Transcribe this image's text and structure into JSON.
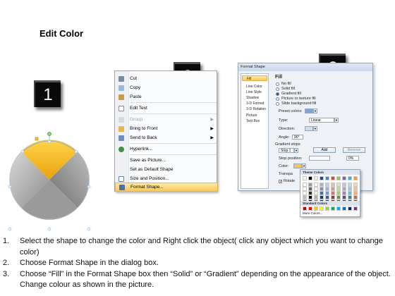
{
  "title": "Edit Color",
  "step_boxes": [
    "1",
    "2",
    "3"
  ],
  "context_menu": {
    "items": [
      {
        "label": "Cut",
        "icon": "scissors-icon",
        "disabled": false,
        "submenu": false
      },
      {
        "label": "Copy",
        "icon": "copy-icon",
        "disabled": false,
        "submenu": false
      },
      {
        "label": "Paste",
        "icon": "paste-icon",
        "disabled": false,
        "submenu": false
      },
      {
        "label": "Edit Text",
        "icon": "edit-text-icon",
        "disabled": false,
        "submenu": false
      },
      {
        "label": "Group",
        "icon": "group-icon",
        "disabled": true,
        "submenu": true
      },
      {
        "label": "Bring to Front",
        "icon": "bring-to-front-icon",
        "disabled": false,
        "submenu": true
      },
      {
        "label": "Send to Back",
        "icon": "send-to-back-icon",
        "disabled": false,
        "submenu": true
      },
      {
        "label": "Hyperlink...",
        "icon": "hyperlink-icon",
        "disabled": false,
        "submenu": false
      },
      {
        "label": "Save as Picture...",
        "icon": "",
        "disabled": false,
        "submenu": false
      },
      {
        "label": "Set as Default Shape",
        "icon": "",
        "disabled": false,
        "submenu": false
      },
      {
        "label": "Size and Position...",
        "icon": "size-position-icon",
        "disabled": false,
        "submenu": false
      },
      {
        "label": "Format Shape...",
        "icon": "format-shape-icon",
        "disabled": false,
        "submenu": false,
        "highlighted": true
      }
    ]
  },
  "dialog": {
    "title": "Format Shape",
    "nav": [
      "Fill",
      "Line Color",
      "Line Style",
      "Shadow",
      "3-D Format",
      "3-D Rotation",
      "Picture",
      "Text Box"
    ],
    "section": "Fill",
    "fill_options": [
      "No fill",
      "Solid fill",
      "Gradient fill",
      "Picture or texture fill",
      "Slide background fill"
    ],
    "selected_fill": "Gradient fill",
    "preset_colors_label": "Preset colors:",
    "type_label": "Type:",
    "type_value": "Linear",
    "direction_label": "Direction:",
    "angle_label": "Angle:",
    "angle_value": "90°",
    "gradient_stops_label": "Gradient stops",
    "stop_value": "Stop 1",
    "add_label": "Add",
    "remove_label": "Remove",
    "stop_position_label": "Stop position:",
    "stop_position_value": "0%",
    "color_label": "Color:",
    "transparency_label": "Transpa",
    "rotate_label": "Rotate"
  },
  "palette": {
    "theme_header": "Theme Colors",
    "standard_header": "Standard Colors",
    "more_label": "More Colors...",
    "theme_top": [
      "#ffffff",
      "#000000",
      "#eeece1",
      "#1f497d",
      "#4f81bd",
      "#c0504d",
      "#9bbb59",
      "#8064a2",
      "#4bacc6",
      "#f79646"
    ],
    "standard": [
      "#c00000",
      "#ff0000",
      "#ffc000",
      "#ffff00",
      "#92d050",
      "#00b050",
      "#00b0f0",
      "#0070c0",
      "#002060",
      "#7030a0"
    ]
  },
  "steps": [
    {
      "num": "1.",
      "text": "Select the shape to change the color and Right click the object( click any object which you want to change color)"
    },
    {
      "num": "2.",
      "text": "Choose Format Shape in the dialog box."
    },
    {
      "num": "3.",
      "text": "Choose “Fill” in the Format Shape box then “Solid” or “Gradient” depending on the appearance of the object. Change colour as shown in the picture."
    }
  ]
}
